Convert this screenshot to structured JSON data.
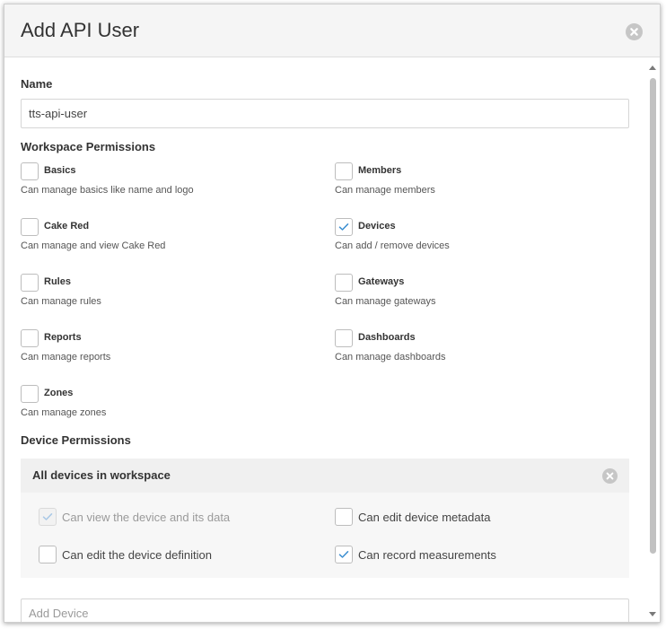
{
  "dialog": {
    "title": "Add API User"
  },
  "name_field": {
    "label": "Name",
    "value": "tts-api-user"
  },
  "workspace_permissions": {
    "label": "Workspace Permissions",
    "items": [
      {
        "title": "Basics",
        "description": "Can manage basics like name and logo",
        "checked": false
      },
      {
        "title": "Members",
        "description": "Can manage members",
        "checked": false
      },
      {
        "title": "Cake Red",
        "description": "Can manage and view Cake Red",
        "checked": false
      },
      {
        "title": "Devices",
        "description": "Can add / remove devices",
        "checked": true
      },
      {
        "title": "Rules",
        "description": "Can manage rules",
        "checked": false
      },
      {
        "title": "Gateways",
        "description": "Can manage gateways",
        "checked": false
      },
      {
        "title": "Reports",
        "description": "Can manage reports",
        "checked": false
      },
      {
        "title": "Dashboards",
        "description": "Can manage dashboards",
        "checked": false
      },
      {
        "title": "Zones",
        "description": "Can manage zones",
        "checked": false
      }
    ]
  },
  "device_permissions": {
    "label": "Device Permissions",
    "panel_title": "All devices in workspace",
    "items": [
      {
        "label": "Can view the device and its data",
        "checked": true,
        "disabled": true
      },
      {
        "label": "Can edit device metadata",
        "checked": false,
        "disabled": false
      },
      {
        "label": "Can edit the device definition",
        "checked": false,
        "disabled": false
      },
      {
        "label": "Can record measurements",
        "checked": true,
        "disabled": false
      }
    ]
  },
  "add_device": {
    "placeholder": "Add Device"
  },
  "icons": {
    "close": "close-circle-icon",
    "check": "checkmark-icon"
  },
  "colors": {
    "check": "#3d8fd1",
    "check_disabled": "#a9c8e6",
    "header_bg": "#f5f5f5"
  }
}
